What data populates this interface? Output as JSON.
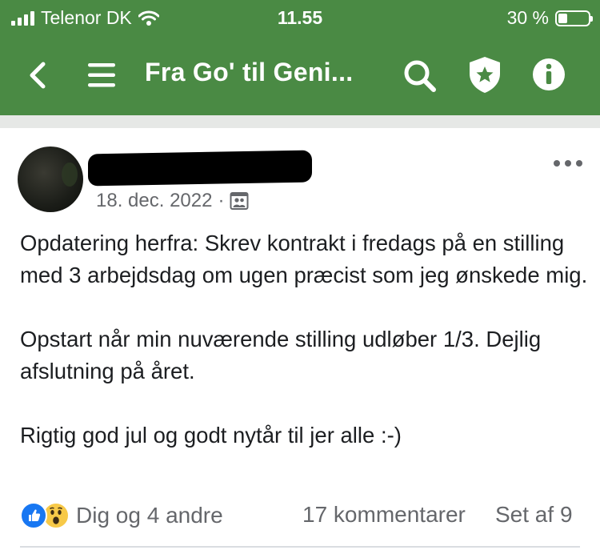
{
  "status_bar": {
    "carrier": "Telenor DK",
    "time": "11.55",
    "battery": "30 %",
    "battery_level": 0.3
  },
  "nav": {
    "title": "Fra Go' til Geni...",
    "icons": [
      "back-icon",
      "menu-icon",
      "search-icon",
      "shield-star-icon",
      "info-icon"
    ]
  },
  "post": {
    "date": "18. dec. 2022",
    "separator": "·",
    "paragraphs": [
      "Opdatering herfra: Skrev kontrakt i fredags på en stilling med 3 arbejdsdag om ugen præcist som jeg ønskede mig.",
      "Opstart når min nuværende stilling udløber 1/3. Dejlig afslutning på året.",
      "Rigtig god jul og godt nytår til jer alle :-)"
    ]
  },
  "footer": {
    "reactions": "Dig og 4 andre",
    "comments": "17 kommentarer",
    "seen": "Set af 9"
  },
  "colors": {
    "header_green": "#4a8a44",
    "like_blue": "#1877f2",
    "wow_yellow": "#f7c948",
    "meta_gray": "#65676b"
  }
}
